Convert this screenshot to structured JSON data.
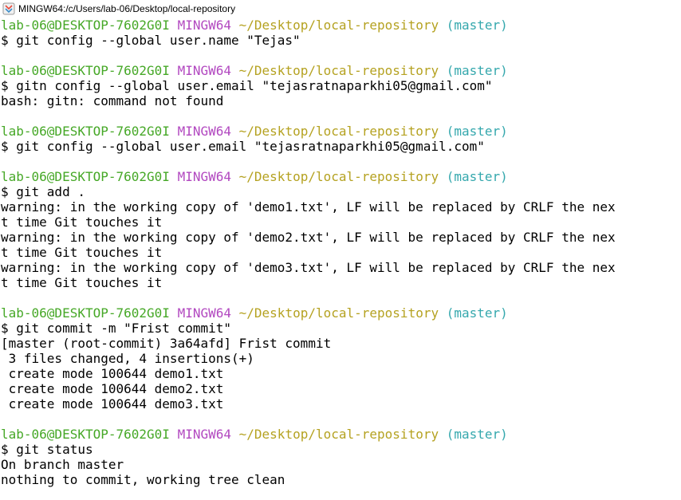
{
  "window": {
    "title": "MINGW64:/c/Users/lab-06/Desktop/local-repository",
    "icon": "git-bash-icon"
  },
  "colors": {
    "user_host": "#46a827",
    "system": "#b248c0",
    "path": "#b5a221",
    "branch": "#35a8ad"
  },
  "prompt": {
    "user_host": "lab-06@DESKTOP-7602G0I",
    "system": "MINGW64",
    "path": "~/Desktop/local-repository",
    "branch": "(master)"
  },
  "blocks": [
    {
      "command": "$ git config --global user.name \"Tejas\"",
      "output": []
    },
    {
      "command": "$ gitn config --global user.email \"tejasratnaparkhi05@gmail.com\"",
      "output": [
        "bash: gitn: command not found"
      ]
    },
    {
      "command": "$ git config --global user.email \"tejasratnaparkhi05@gmail.com\"",
      "output": []
    },
    {
      "command": "$ git add .",
      "output": [
        "warning: in the working copy of 'demo1.txt', LF will be replaced by CRLF the nex",
        "t time Git touches it",
        "warning: in the working copy of 'demo2.txt', LF will be replaced by CRLF the nex",
        "t time Git touches it",
        "warning: in the working copy of 'demo3.txt', LF will be replaced by CRLF the nex",
        "t time Git touches it"
      ]
    },
    {
      "command": "$ git commit -m \"Frist commit\"",
      "output": [
        "[master (root-commit) 3a64afd] Frist commit",
        " 3 files changed, 4 insertions(+)",
        " create mode 100644 demo1.txt",
        " create mode 100644 demo2.txt",
        " create mode 100644 demo3.txt"
      ]
    },
    {
      "command": "$ git status",
      "output": [
        "On branch master",
        "nothing to commit, working tree clean"
      ]
    }
  ]
}
